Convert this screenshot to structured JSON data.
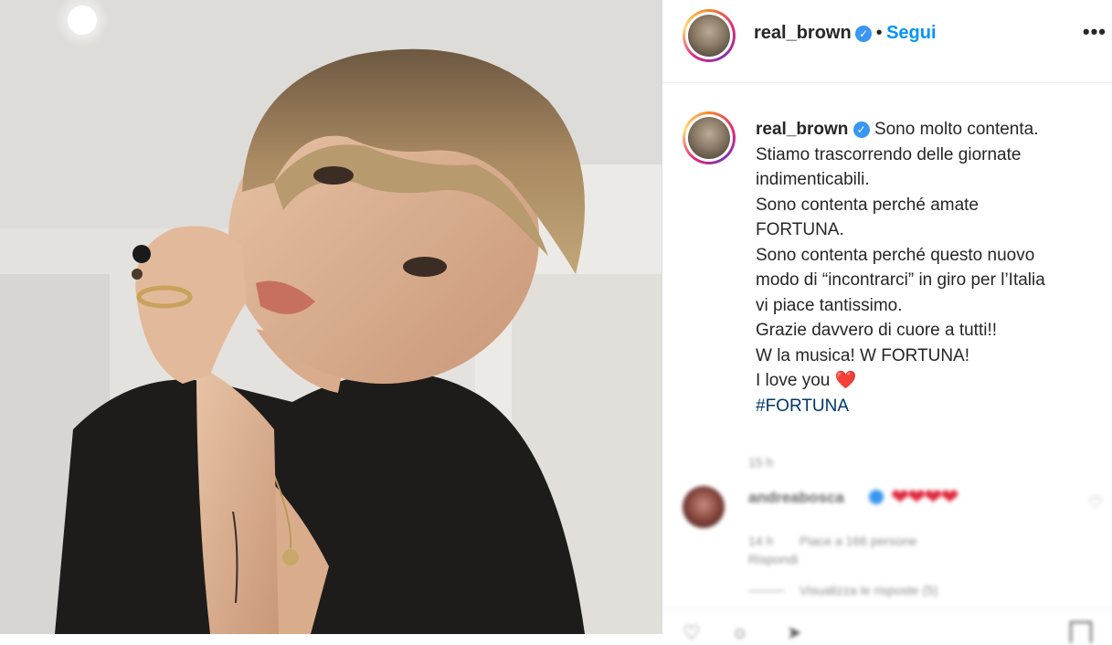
{
  "header": {
    "username": "real_brown",
    "separator": "•",
    "follow_label": "Segui",
    "more_label": "•••",
    "verified_icon": "check-icon"
  },
  "caption": {
    "username": "real_brown",
    "lines": [
      "Sono molto contenta.",
      "Stiamo trascorrendo delle giornate",
      "indimenticabili.",
      "Sono contenta perché amate",
      "FORTUNA.",
      "Sono contenta perché questo nuovo",
      "modo di “incontrarci” in giro per l’Italia",
      "vi piace tantissimo.",
      "Grazie davvero di cuore a tutti!!",
      "W la musica! W FORTUNA!",
      "I love you"
    ],
    "heart_emoji": "❤️",
    "hashtag": "#FORTUNA"
  },
  "comments": {
    "caption_time": "15 h",
    "commenter": "andreabosca",
    "comment_text": "❤❤❤❤",
    "comment_time": "14 h",
    "likes_text": "Piace a 166 persone",
    "reply_label": "Rispondi",
    "view_replies": "Visualizza le risposte (5)"
  },
  "colors": {
    "accent": "#0095f6",
    "verified": "#3897f0",
    "heart": "#e0243a",
    "hashtag": "#00376b"
  }
}
